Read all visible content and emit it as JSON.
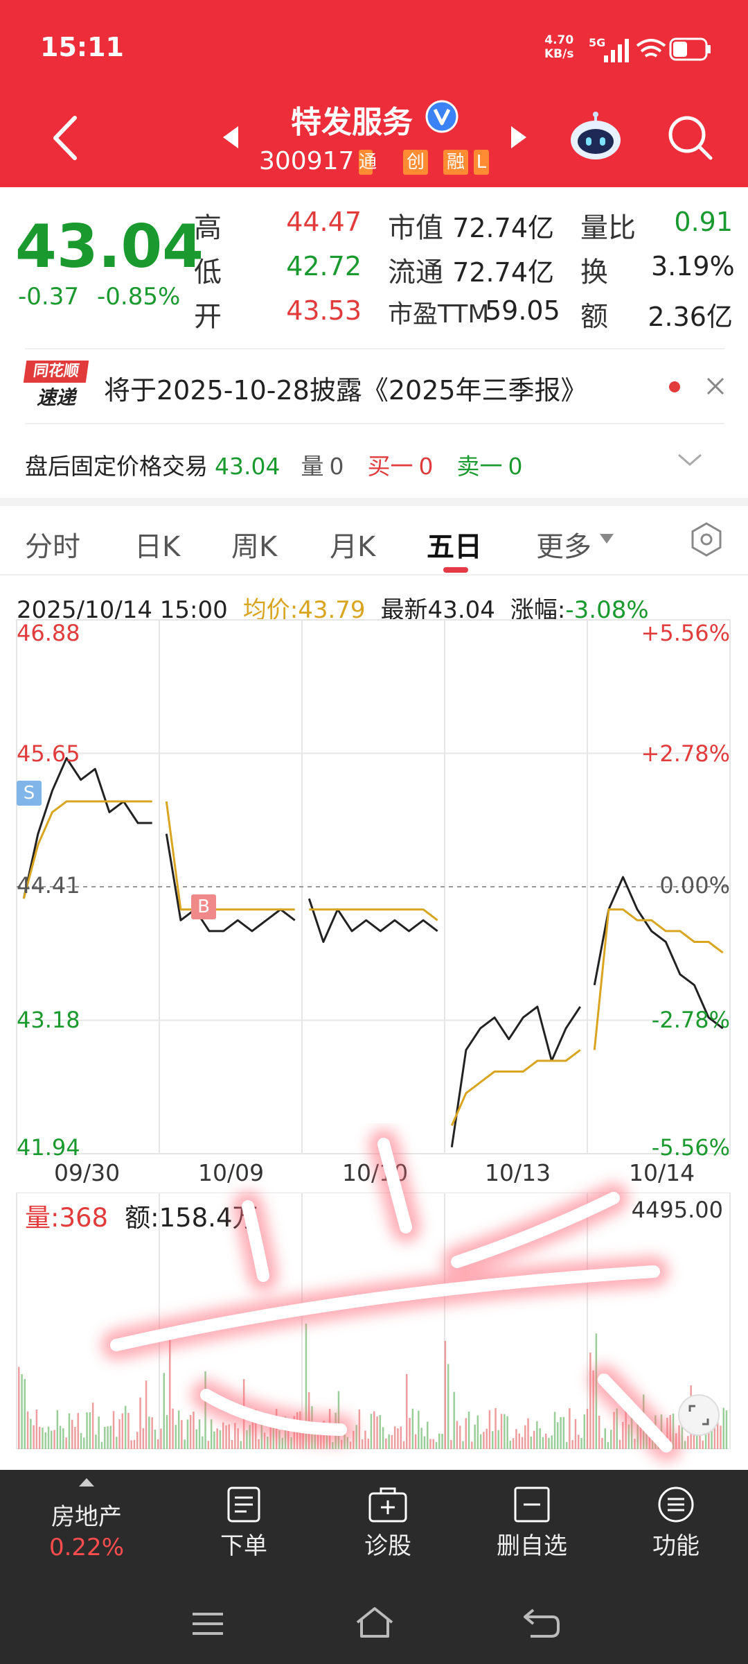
{
  "status": {
    "time": "15:11",
    "speed_value": "4.70",
    "speed_unit": "KB/s",
    "network": "5G"
  },
  "header": {
    "stock_name": "特发服务",
    "stock_code": "300917",
    "tags": [
      "通",
      "创",
      "融",
      "L"
    ]
  },
  "quote": {
    "price": "43.04",
    "change": "-0.37",
    "change_pct": "-0.85%",
    "high_label": "高",
    "high": "44.47",
    "low_label": "低",
    "low": "42.72",
    "open_label": "开",
    "open": "43.53",
    "mcap_label": "市值",
    "mcap": "72.74亿",
    "float_label": "流通",
    "float": "72.74亿",
    "pe_label": "市盈TTM",
    "pe": "59.05",
    "vol_ratio_label": "量比",
    "vol_ratio": "0.91",
    "turnover_label": "换",
    "turnover": "3.19%",
    "amount_label": "额",
    "amount": "2.36亿"
  },
  "notice": {
    "badge_top": "同花顺",
    "badge_bottom": "速递",
    "text": "将于2025-10-28披露《2025年三季报》"
  },
  "after_hours": {
    "label": "盘后固定价格交易",
    "price": "43.04",
    "vol_label": "量",
    "vol": "0",
    "buy_label": "买一",
    "buy": "0",
    "sell_label": "卖一",
    "sell": "0"
  },
  "tabs": [
    "分时",
    "日K",
    "周K",
    "月K",
    "五日",
    "更多"
  ],
  "chart_info": {
    "datetime": "2025/10/14 15:00",
    "avg": "均价:43.79",
    "latest": "最新43.04",
    "change_label": "涨幅:",
    "change": "-3.08%"
  },
  "chart_data": {
    "type": "line",
    "series": [
      {
        "values": [
          44.3,
          44.9,
          45.3,
          45.6,
          45.4,
          45.5,
          45.1,
          45.2,
          45.0,
          45.0,
          44.9,
          44.1,
          44.2,
          44.0,
          44.0,
          44.1,
          44.0,
          44.1,
          44.2,
          44.1,
          44.3,
          43.9,
          44.2,
          44.0,
          44.1,
          44.0,
          44.1,
          44.0,
          44.1,
          44.0,
          42.0,
          42.9,
          43.1,
          43.2,
          43.0,
          43.2,
          43.3,
          42.8,
          43.1,
          43.3,
          43.5,
          44.2,
          44.5,
          44.2,
          44.0,
          43.9,
          43.6,
          43.5,
          43.2,
          43.1
        ]
      },
      {
        "values": [
          44.3,
          44.8,
          45.1,
          45.2,
          45.2,
          45.2,
          45.2,
          45.2,
          45.2,
          45.2,
          45.2,
          44.2,
          44.2,
          44.2,
          44.2,
          44.2,
          44.2,
          44.2,
          44.2,
          44.2,
          44.2,
          44.2,
          44.2,
          44.2,
          44.2,
          44.2,
          44.2,
          44.2,
          44.2,
          44.1,
          42.2,
          42.5,
          42.6,
          42.7,
          42.7,
          42.7,
          42.8,
          42.8,
          42.8,
          42.9,
          42.9,
          44.2,
          44.2,
          44.1,
          44.1,
          44.0,
          44.0,
          43.9,
          43.9,
          43.8
        ]
      }
    ],
    "x_labels": [
      "09/30",
      "10/09",
      "10/10",
      "10/13",
      "10/14"
    ],
    "y_labels_left": [
      "46.88",
      "45.65",
      "44.41",
      "43.18",
      "41.94"
    ],
    "y_labels_right": [
      "+5.56%",
      "+2.78%",
      "0.00%",
      "-2.78%",
      "-5.56%"
    ],
    "ylim": [
      41.94,
      46.88
    ],
    "markers": [
      "S",
      "B"
    ]
  },
  "volume": {
    "vol_label": "量:",
    "vol": "368",
    "amt_label": "额:",
    "amt": "158.4万",
    "max": "4495.00"
  },
  "toolbar": {
    "sector": "房地产",
    "sector_change": "0.22%",
    "order": "下单",
    "diagnose": "诊股",
    "remove": "删自选",
    "functions": "功能"
  },
  "colors": {
    "header_red": "#ee2d3a",
    "rise": "#e23b3b",
    "fall": "#1a9a2e",
    "avg_line": "#d9a520"
  }
}
